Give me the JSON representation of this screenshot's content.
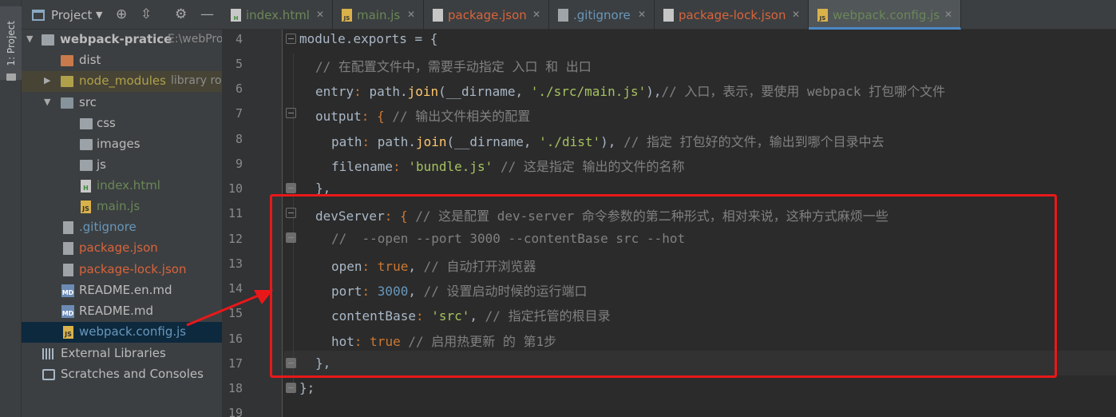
{
  "toolstrip": {
    "project_label": "1: Project"
  },
  "project_panel": {
    "title": "Project",
    "root": {
      "name": "webpack-pratice",
      "path": "E:\\webPro"
    },
    "items": [
      {
        "label": "dist",
        "color": "#bbbbbb"
      },
      {
        "label": "node_modules",
        "hint": "library ro",
        "color": "#b0a04a"
      },
      {
        "label": "src",
        "color": "#bbbbbb"
      },
      {
        "label": "css",
        "color": "#bbbbbb"
      },
      {
        "label": "images",
        "color": "#bbbbbb"
      },
      {
        "label": "js",
        "color": "#bbbbbb"
      },
      {
        "label": "index.html",
        "color": "#6a8759"
      },
      {
        "label": "main.js",
        "color": "#6a8759"
      },
      {
        "label": ".gitignore",
        "color": "#6897bb"
      },
      {
        "label": "package.json",
        "color": "#d8643c"
      },
      {
        "label": "package-lock.json",
        "color": "#d8643c"
      },
      {
        "label": "README.en.md",
        "color": "#bbbbbb"
      },
      {
        "label": "README.md",
        "color": "#bbbbbb"
      },
      {
        "label": "webpack.config.js",
        "color": "#6897bb"
      },
      {
        "label": "External Libraries",
        "color": "#bbbbbb"
      },
      {
        "label": "Scratches and Consoles",
        "color": "#bbbbbb"
      }
    ]
  },
  "tabs": [
    {
      "label": "index.html",
      "icon": "html-file-icon",
      "color": "#6a8759"
    },
    {
      "label": "main.js",
      "icon": "js-file-icon",
      "color": "#6a8759"
    },
    {
      "label": "package.json",
      "icon": "json-file-icon",
      "color": "#d8643c"
    },
    {
      "label": ".gitignore",
      "icon": "gitignore-file-icon",
      "color": "#6897bb"
    },
    {
      "label": "package-lock.json",
      "icon": "json-file-icon",
      "color": "#d8643c"
    },
    {
      "label": "webpack.config.js",
      "icon": "js-file-icon",
      "color": "#6a8759",
      "active": true
    }
  ],
  "editor": {
    "line_numbers": [
      "4",
      "5",
      "6",
      "7",
      "8",
      "9",
      "10",
      "11",
      "12",
      "13",
      "14",
      "15",
      "16",
      "17",
      "18",
      "19"
    ],
    "lines": {
      "l4": [
        "module",
        ".",
        "exports",
        " = {"
      ],
      "l5": "// 在配置文件中，需要手动指定 入口 和 出口",
      "l6": [
        "entry",
        ": ",
        "path",
        ".",
        "join",
        "(__dirname, ",
        "'./src/main.js'",
        "),",
        "// 入口，表示，要使用 webpack 打包哪个文件"
      ],
      "l7": [
        "output",
        ": { ",
        "// 输出文件相关的配置"
      ],
      "l8": [
        "path",
        ": ",
        "path",
        ".",
        "join",
        "(__dirname, ",
        "'./dist'",
        "), ",
        "// 指定 打包好的文件，输出到哪个目录中去"
      ],
      "l9": [
        "filename",
        ": ",
        "'bundle.js'",
        " ",
        "// 这是指定 输出的文件的名称"
      ],
      "l10": "},",
      "l11": [
        "devServer",
        ": { ",
        "// 这是配置 dev-server 命令参数的第二种形式，相对来说，这种方式麻烦一些"
      ],
      "l12": "//  --open --port 3000 --contentBase src --hot",
      "l13": [
        "open",
        ": ",
        "true",
        ", ",
        "// 自动打开浏览器"
      ],
      "l14": [
        "port",
        ": ",
        "3000",
        ", ",
        "// 设置启动时候的运行端口"
      ],
      "l15": [
        "contentBase",
        ": ",
        "'src'",
        ", ",
        "// 指定托管的根目录"
      ],
      "l16": [
        "hot",
        ": ",
        "true",
        " ",
        "// 启用热更新 的 第1步"
      ],
      "l17": "},",
      "l18": "};"
    }
  },
  "colors": {
    "annotation_red": "#e8181a",
    "accent_blue": "#4a88c7"
  }
}
